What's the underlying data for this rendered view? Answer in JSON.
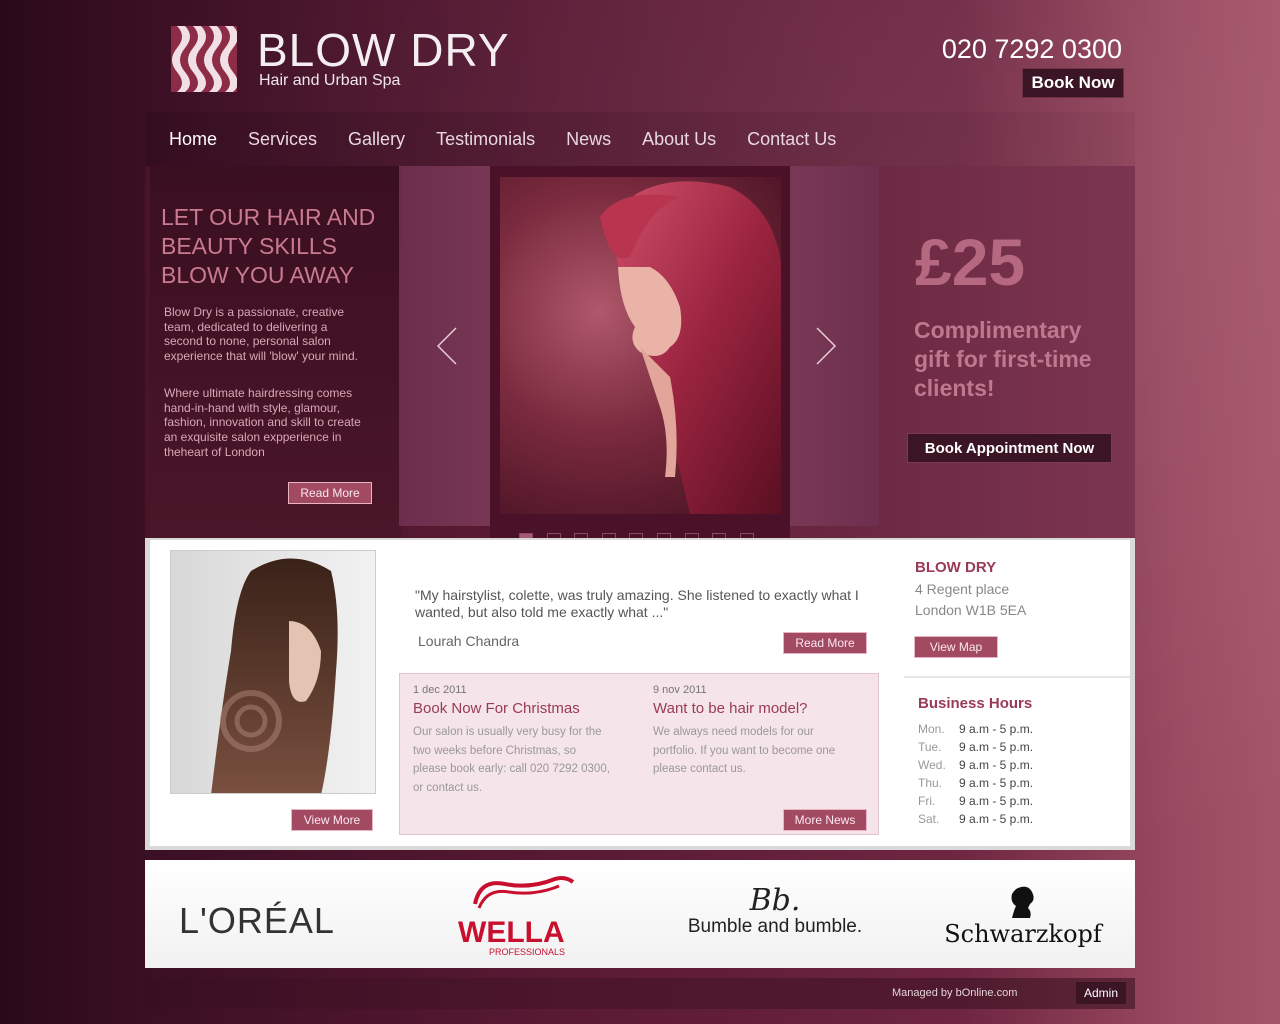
{
  "header": {
    "brand": "BLOW DRY",
    "tagline": "Hair and Urban Spa",
    "phone": "020 7292 0300",
    "book_now": "Book Now"
  },
  "nav": {
    "items": [
      "Home",
      "Services",
      "Gallery",
      "Testimonials",
      "News",
      "About Us",
      "Contact Us"
    ]
  },
  "hero": {
    "headline": "LET OUR HAIR AND BEAUTY SKILLS BLOW YOU AWAY",
    "para1": "Blow Dry is a passionate, creative team, dedicated to delivering a second to none, personal salon experience that will 'blow' your mind.",
    "para2": "Where ultimate hairdressing comes hand-in-hand with style, glamour, fashion, innovation and skill to create an exquisite salon expperience in theheart of London",
    "read_more": "Read More",
    "price": "£25",
    "offer": "Complimentary gift for first-time clients!",
    "book_appointment": "Book Appointment Now"
  },
  "testimonial": {
    "quote": "\"My hairstylist, colette, was truly amazing. She listened to exactly what I wanted, but also told me exactly what ...\"",
    "author": "Lourah Chandra",
    "read_more": "Read More"
  },
  "gallery": {
    "view_more": "View More"
  },
  "news": {
    "items": [
      {
        "date": "1 dec 2011",
        "title": "Book Now For Christmas",
        "text": "Our salon is usually very busy for the two weeks before Christmas, so please book early: call 020 7292 0300, or contact us."
      },
      {
        "date": "9 nov 2011",
        "title": "Want to be hair model?",
        "text": "We always need models for our portfolio. If you want to become one please contact us."
      }
    ],
    "more_news": "More News"
  },
  "address": {
    "name": "BLOW DRY",
    "line1": "4 Regent place",
    "line2": "London  W1B 5EA",
    "view_map": "View Map"
  },
  "hours": {
    "title": "Business Hours",
    "rows": [
      {
        "day": "Mon.",
        "time": "9 a.m - 5 p.m."
      },
      {
        "day": "Tue.",
        "time": "9 a.m - 5 p.m."
      },
      {
        "day": "Wed.",
        "time": "9 a.m - 5 p.m."
      },
      {
        "day": "Thu.",
        "time": "9 a.m - 5 p.m."
      },
      {
        "day": "Fri.",
        "time": "9 a.m - 5 p.m."
      },
      {
        "day": "Sat.",
        "time": "9 a.m - 5 p.m."
      }
    ]
  },
  "brands": {
    "loreal": "L'ORÉAL",
    "wella": "WELLA",
    "wella_sub": "PROFESSIONALS",
    "bb_mark": "Bb.",
    "bumble": "Bumble and bumble.",
    "schwarzkopf": "Schwarzkopf"
  },
  "footer": {
    "managed": "Managed by bOnline.com",
    "admin": "Admin"
  },
  "slider": {
    "dot_count": 9,
    "active_dot": 1
  }
}
